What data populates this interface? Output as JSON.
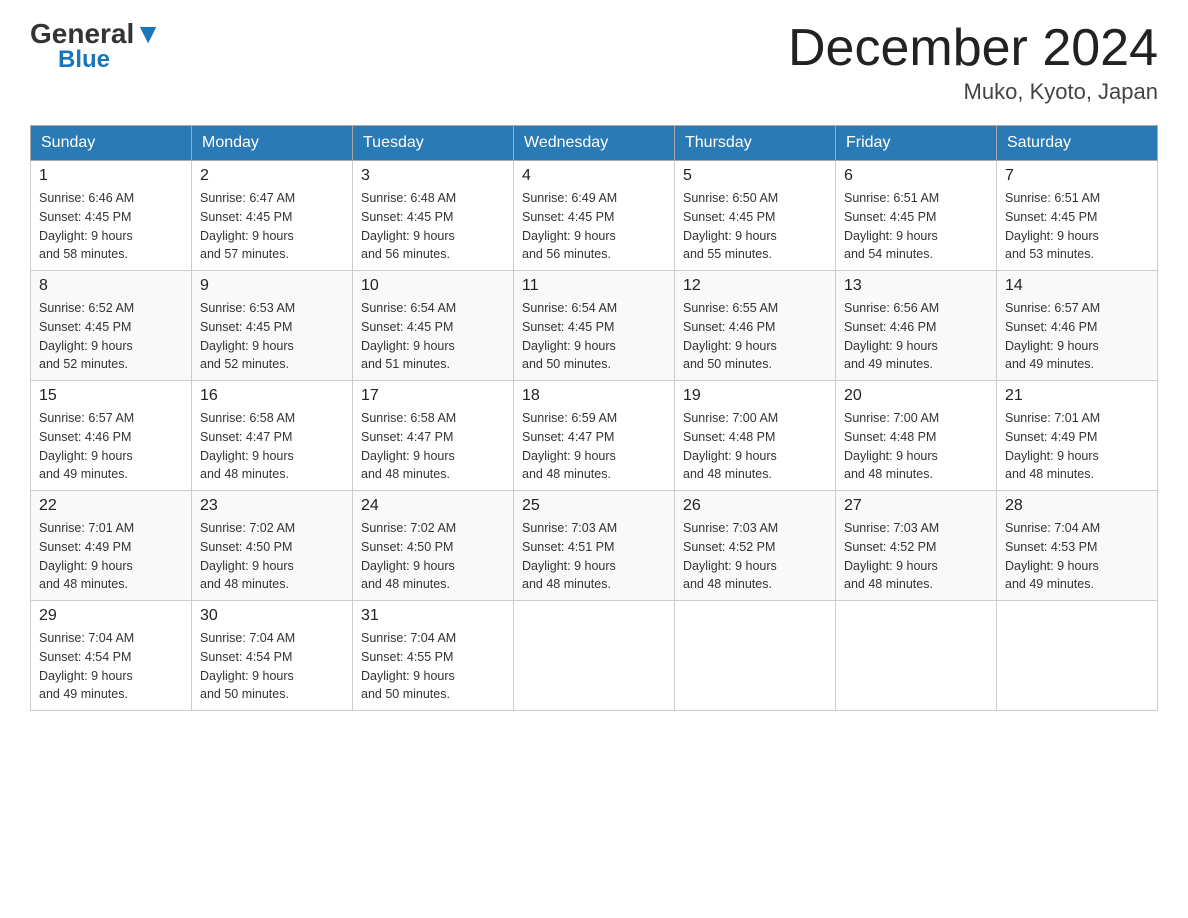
{
  "header": {
    "logo_general": "General",
    "logo_blue": "Blue",
    "month_title": "December 2024",
    "location": "Muko, Kyoto, Japan"
  },
  "days_of_week": [
    "Sunday",
    "Monday",
    "Tuesday",
    "Wednesday",
    "Thursday",
    "Friday",
    "Saturday"
  ],
  "weeks": [
    [
      {
        "day": "1",
        "sunrise": "6:46 AM",
        "sunset": "4:45 PM",
        "daylight": "9 hours and 58 minutes."
      },
      {
        "day": "2",
        "sunrise": "6:47 AM",
        "sunset": "4:45 PM",
        "daylight": "9 hours and 57 minutes."
      },
      {
        "day": "3",
        "sunrise": "6:48 AM",
        "sunset": "4:45 PM",
        "daylight": "9 hours and 56 minutes."
      },
      {
        "day": "4",
        "sunrise": "6:49 AM",
        "sunset": "4:45 PM",
        "daylight": "9 hours and 56 minutes."
      },
      {
        "day": "5",
        "sunrise": "6:50 AM",
        "sunset": "4:45 PM",
        "daylight": "9 hours and 55 minutes."
      },
      {
        "day": "6",
        "sunrise": "6:51 AM",
        "sunset": "4:45 PM",
        "daylight": "9 hours and 54 minutes."
      },
      {
        "day": "7",
        "sunrise": "6:51 AM",
        "sunset": "4:45 PM",
        "daylight": "9 hours and 53 minutes."
      }
    ],
    [
      {
        "day": "8",
        "sunrise": "6:52 AM",
        "sunset": "4:45 PM",
        "daylight": "9 hours and 52 minutes."
      },
      {
        "day": "9",
        "sunrise": "6:53 AM",
        "sunset": "4:45 PM",
        "daylight": "9 hours and 52 minutes."
      },
      {
        "day": "10",
        "sunrise": "6:54 AM",
        "sunset": "4:45 PM",
        "daylight": "9 hours and 51 minutes."
      },
      {
        "day": "11",
        "sunrise": "6:54 AM",
        "sunset": "4:45 PM",
        "daylight": "9 hours and 50 minutes."
      },
      {
        "day": "12",
        "sunrise": "6:55 AM",
        "sunset": "4:46 PM",
        "daylight": "9 hours and 50 minutes."
      },
      {
        "day": "13",
        "sunrise": "6:56 AM",
        "sunset": "4:46 PM",
        "daylight": "9 hours and 49 minutes."
      },
      {
        "day": "14",
        "sunrise": "6:57 AM",
        "sunset": "4:46 PM",
        "daylight": "9 hours and 49 minutes."
      }
    ],
    [
      {
        "day": "15",
        "sunrise": "6:57 AM",
        "sunset": "4:46 PM",
        "daylight": "9 hours and 49 minutes."
      },
      {
        "day": "16",
        "sunrise": "6:58 AM",
        "sunset": "4:47 PM",
        "daylight": "9 hours and 48 minutes."
      },
      {
        "day": "17",
        "sunrise": "6:58 AM",
        "sunset": "4:47 PM",
        "daylight": "9 hours and 48 minutes."
      },
      {
        "day": "18",
        "sunrise": "6:59 AM",
        "sunset": "4:47 PM",
        "daylight": "9 hours and 48 minutes."
      },
      {
        "day": "19",
        "sunrise": "7:00 AM",
        "sunset": "4:48 PM",
        "daylight": "9 hours and 48 minutes."
      },
      {
        "day": "20",
        "sunrise": "7:00 AM",
        "sunset": "4:48 PM",
        "daylight": "9 hours and 48 minutes."
      },
      {
        "day": "21",
        "sunrise": "7:01 AM",
        "sunset": "4:49 PM",
        "daylight": "9 hours and 48 minutes."
      }
    ],
    [
      {
        "day": "22",
        "sunrise": "7:01 AM",
        "sunset": "4:49 PM",
        "daylight": "9 hours and 48 minutes."
      },
      {
        "day": "23",
        "sunrise": "7:02 AM",
        "sunset": "4:50 PM",
        "daylight": "9 hours and 48 minutes."
      },
      {
        "day": "24",
        "sunrise": "7:02 AM",
        "sunset": "4:50 PM",
        "daylight": "9 hours and 48 minutes."
      },
      {
        "day": "25",
        "sunrise": "7:03 AM",
        "sunset": "4:51 PM",
        "daylight": "9 hours and 48 minutes."
      },
      {
        "day": "26",
        "sunrise": "7:03 AM",
        "sunset": "4:52 PM",
        "daylight": "9 hours and 48 minutes."
      },
      {
        "day": "27",
        "sunrise": "7:03 AM",
        "sunset": "4:52 PM",
        "daylight": "9 hours and 48 minutes."
      },
      {
        "day": "28",
        "sunrise": "7:04 AM",
        "sunset": "4:53 PM",
        "daylight": "9 hours and 49 minutes."
      }
    ],
    [
      {
        "day": "29",
        "sunrise": "7:04 AM",
        "sunset": "4:54 PM",
        "daylight": "9 hours and 49 minutes."
      },
      {
        "day": "30",
        "sunrise": "7:04 AM",
        "sunset": "4:54 PM",
        "daylight": "9 hours and 50 minutes."
      },
      {
        "day": "31",
        "sunrise": "7:04 AM",
        "sunset": "4:55 PM",
        "daylight": "9 hours and 50 minutes."
      },
      null,
      null,
      null,
      null
    ]
  ],
  "labels": {
    "sunrise_prefix": "Sunrise: ",
    "sunset_prefix": "Sunset: ",
    "daylight_prefix": "Daylight: "
  }
}
